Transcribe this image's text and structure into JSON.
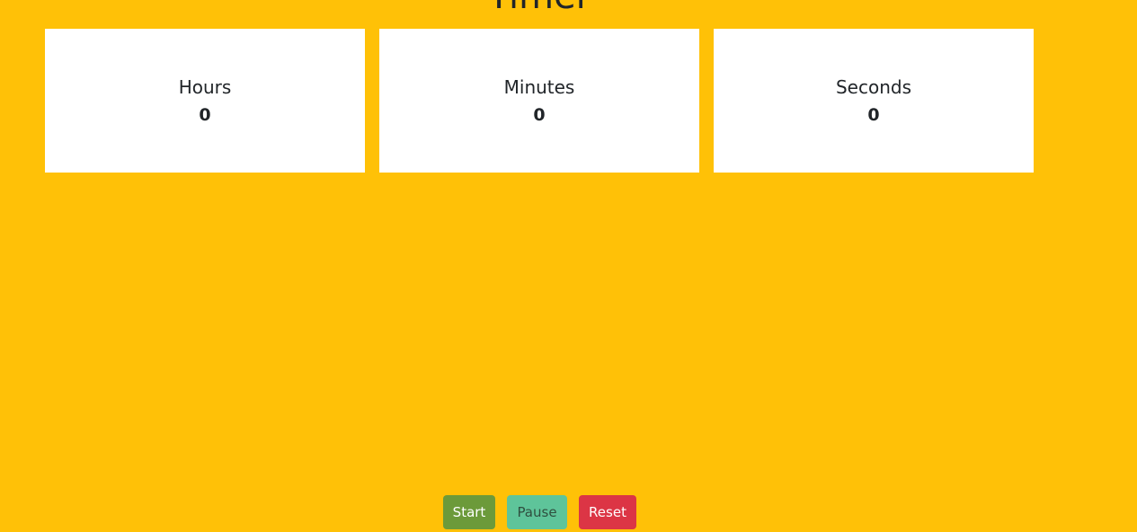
{
  "title": "Timer",
  "cards": [
    {
      "label": "Hours",
      "value": "0"
    },
    {
      "label": "Minutes",
      "value": "0"
    },
    {
      "label": "Seconds",
      "value": "0"
    }
  ],
  "controls": {
    "start_label": "Start",
    "pause_label": "Pause",
    "reset_label": "Reset"
  },
  "colors": {
    "background": "#ffc107",
    "card": "#ffffff",
    "start": "#6c9a3a",
    "pause": "#5ec49a",
    "reset": "#dc3545"
  }
}
